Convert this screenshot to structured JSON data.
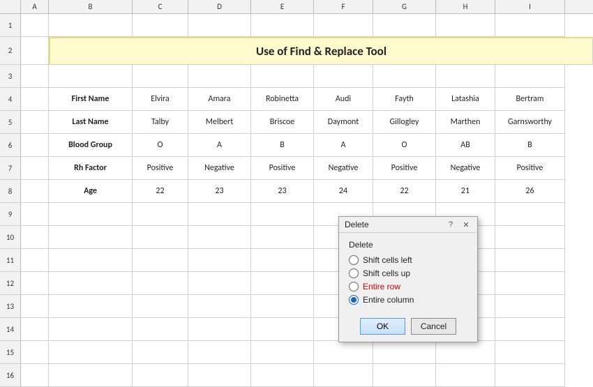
{
  "sheet": {
    "title": "Use of Find & Replace Tool",
    "col_headers": [
      "",
      "A",
      "B",
      "C",
      "D",
      "E",
      "F",
      "G",
      "H",
      "I"
    ],
    "rows": [
      {
        "num": "1",
        "cells": [
          "",
          "",
          "",
          "",
          "",
          "",
          "",
          "",
          ""
        ]
      },
      {
        "num": "2",
        "cells": [
          "title",
          "",
          "",
          "",
          "",
          "",
          "",
          "",
          ""
        ]
      },
      {
        "num": "3",
        "cells": [
          "",
          "",
          "",
          "",
          "",
          "",
          "",
          "",
          ""
        ]
      },
      {
        "num": "4",
        "cells": [
          "",
          "First Name",
          "Elvira",
          "Amara",
          "Robinetta",
          "Audi",
          "Fayth",
          "Latashia",
          "Bertram"
        ]
      },
      {
        "num": "5",
        "cells": [
          "",
          "Last Name",
          "Talby",
          "Melbert",
          "Briscoe",
          "Daymont",
          "Gillogley",
          "Marthen",
          "Garnsworthy"
        ]
      },
      {
        "num": "6",
        "cells": [
          "",
          "Blood Group",
          "O",
          "A",
          "B",
          "A",
          "O",
          "AB",
          "B"
        ]
      },
      {
        "num": "7",
        "cells": [
          "",
          "Rh Factor",
          "Positive",
          "Negative",
          "Positive",
          "Negative",
          "Positive",
          "Negative",
          "Positive"
        ]
      },
      {
        "num": "8",
        "cells": [
          "",
          "Age",
          "22",
          "23",
          "23",
          "24",
          "22",
          "21",
          "26"
        ]
      },
      {
        "num": "9",
        "cells": [
          "",
          "",
          "",
          "",
          "",
          "",
          "",
          "",
          ""
        ]
      },
      {
        "num": "10",
        "cells": [
          "",
          "",
          "",
          "",
          "",
          "",
          "",
          "",
          ""
        ]
      },
      {
        "num": "11",
        "cells": [
          "",
          "",
          "",
          "",
          "",
          "",
          "",
          "",
          ""
        ]
      },
      {
        "num": "12",
        "cells": [
          "",
          "",
          "",
          "",
          "",
          "",
          "",
          "",
          ""
        ]
      },
      {
        "num": "13",
        "cells": [
          "",
          "",
          "",
          "",
          "",
          "",
          "",
          "",
          ""
        ]
      },
      {
        "num": "14",
        "cells": [
          "",
          "",
          "",
          "",
          "",
          "",
          "",
          "",
          ""
        ]
      },
      {
        "num": "15",
        "cells": [
          "",
          "",
          "",
          "",
          "",
          "",
          "",
          "",
          ""
        ]
      },
      {
        "num": "16",
        "cells": [
          "",
          "",
          "",
          "",
          "",
          "",
          "",
          "",
          ""
        ]
      }
    ]
  },
  "dialog": {
    "title": "Delete",
    "section_label": "Delete",
    "options": [
      {
        "id": "shift_left",
        "label": "Shift cells left",
        "label_color": "normal",
        "checked": false
      },
      {
        "id": "shift_up",
        "label": "Shift cells up",
        "label_color": "normal",
        "checked": false
      },
      {
        "id": "entire_row",
        "label": "Entire row",
        "label_color": "red",
        "checked": false
      },
      {
        "id": "entire_col",
        "label": "Entire column",
        "label_color": "normal",
        "checked": true
      }
    ],
    "ok_label": "OK",
    "cancel_label": "Cancel",
    "help_icon": "?",
    "close_icon": "✕"
  }
}
